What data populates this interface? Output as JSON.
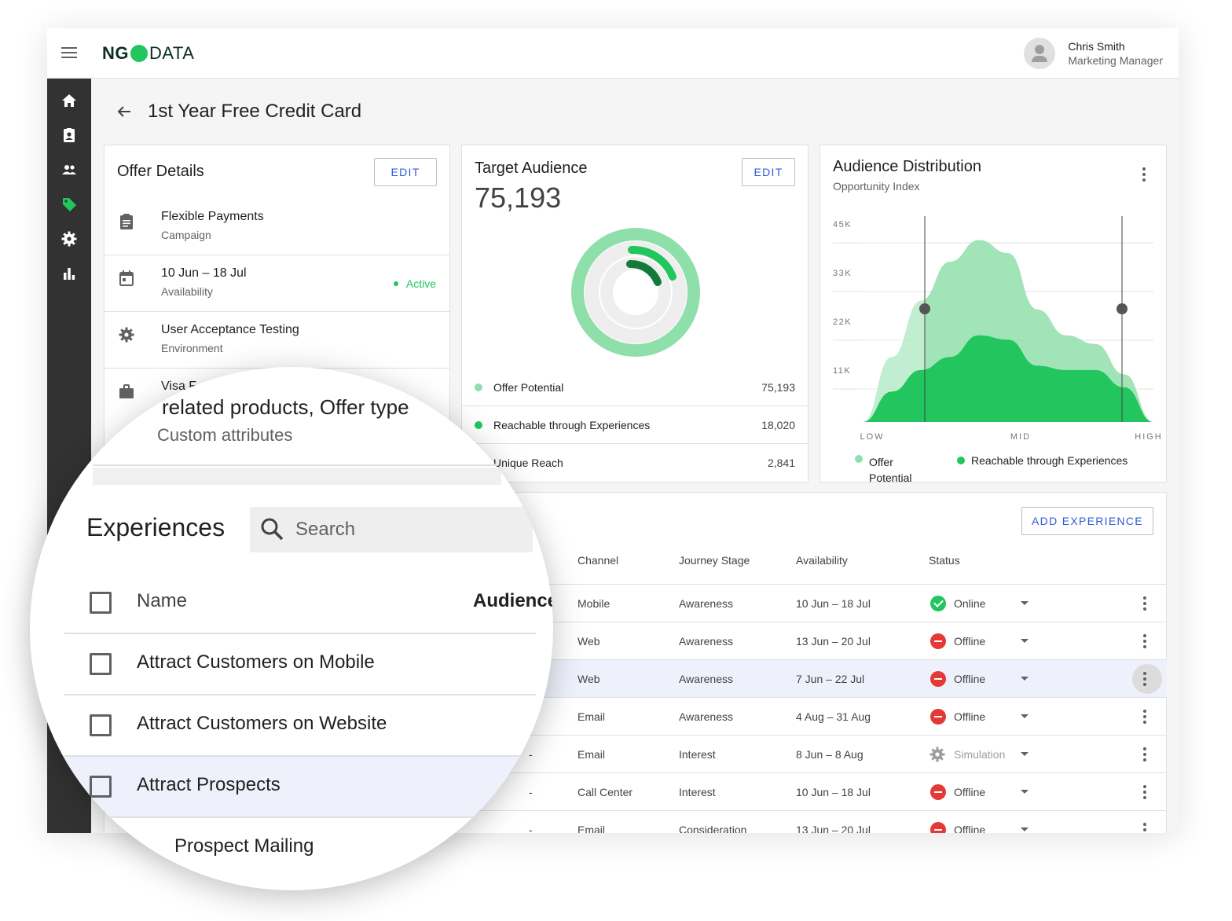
{
  "app": {
    "logo_left": "NG",
    "logo_right": "DATA",
    "user_name": "Chris Smith",
    "user_role": "Marketing Manager"
  },
  "sidebar": {
    "items": [
      {
        "icon": "home-icon"
      },
      {
        "icon": "contact-badge-icon"
      },
      {
        "icon": "people-icon"
      },
      {
        "icon": "tag-icon",
        "active": true
      },
      {
        "icon": "gear-icon"
      },
      {
        "icon": "bar-chart-icon"
      }
    ]
  },
  "page": {
    "title": "1st Year Free Credit Card"
  },
  "offer_details": {
    "title": "Offer Details",
    "edit_label": "EDIT",
    "rows": [
      {
        "icon": "clipboard-icon",
        "primary": "Flexible Payments",
        "secondary": "Campaign"
      },
      {
        "icon": "calendar-icon",
        "primary": "10 Jun – 18 Jul",
        "secondary": "Availability",
        "badge": "Active"
      },
      {
        "icon": "gear-icon",
        "primary": "User Acceptance Testing",
        "secondary": "Environment"
      },
      {
        "icon": "briefcase-icon",
        "primary": "Visa F",
        "secondary": ""
      }
    ]
  },
  "target_audience": {
    "title": "Target Audience",
    "edit_label": "EDIT",
    "total": "75,193",
    "legend": [
      {
        "label": "Offer Potential",
        "value": "75,193",
        "color": "#8fdfaa"
      },
      {
        "label": "Reachable through Experiences",
        "value": "18,020",
        "color": "#22c55e"
      },
      {
        "label": "Unique Reach",
        "value": "2,841",
        "color": "#137a3a"
      }
    ]
  },
  "audience_distribution": {
    "title": "Audience Distribution",
    "subtitle": "Opportunity Index",
    "legend_offer": "Offer",
    "legend_offer_2": "Potential",
    "legend_reach": "Reachable through Experiences"
  },
  "chart_data": {
    "type": "area",
    "x_ticks": [
      "LOW",
      "MID",
      "HIGH"
    ],
    "y_ticks": [
      "45K",
      "33K",
      "22K",
      "11K"
    ],
    "ylim": [
      0,
      45000
    ],
    "x": [
      0,
      0.1,
      0.2,
      0.3,
      0.4,
      0.5,
      0.6,
      0.7,
      0.8,
      0.9,
      1.0
    ],
    "series": [
      {
        "name": "Offer Potential",
        "color": "#8fdfaa",
        "values": [
          0,
          15000,
          28000,
          37000,
          42000,
          39000,
          26000,
          20000,
          18000,
          11000,
          0
        ]
      },
      {
        "name": "Reachable through Experiences",
        "color": "#22c55e",
        "values": [
          0,
          7000,
          12000,
          15000,
          20000,
          19000,
          13000,
          12000,
          12000,
          8000,
          0
        ]
      }
    ],
    "grid": true
  },
  "experiences": {
    "add_label": "ADD EXPERIENCE",
    "columns": [
      "Channel",
      "Journey Stage",
      "Availability",
      "Status"
    ],
    "rows": [
      {
        "channel": "Mobile",
        "stage": "Awareness",
        "availability": "10 Jun – 18 Jul",
        "status": "Online",
        "kind": "online",
        "dash": ""
      },
      {
        "channel": "Web",
        "stage": "Awareness",
        "availability": "13 Jun – 20 Jul",
        "status": "Offline",
        "kind": "offline",
        "dash": ""
      },
      {
        "channel": "Web",
        "stage": "Awareness",
        "availability": "7 Jun – 22 Jul",
        "status": "Offline",
        "kind": "offline",
        "dash": ""
      },
      {
        "channel": "Email",
        "stage": "Awareness",
        "availability": "4 Aug – 31 Aug",
        "status": "Offline",
        "kind": "offline",
        "dash": ""
      },
      {
        "channel": "Email",
        "stage": "Interest",
        "availability": "8 Jun – 8 Aug",
        "status": "Simulation",
        "kind": "sim",
        "dash": "-"
      },
      {
        "channel": "Call Center",
        "stage": "Interest",
        "availability": "10 Jun – 18 Jul",
        "status": "Offline",
        "kind": "offline",
        "dash": "-"
      },
      {
        "channel": "Email",
        "stage": "Consideration",
        "availability": "13 Jun – 20 Jul",
        "status": "Offline",
        "kind": "offline",
        "dash": "-"
      }
    ]
  },
  "magnifier": {
    "top_text": "related products, Offer type",
    "top_sub": "Custom attributes",
    "section_title": "Experiences",
    "search_placeholder": "Search",
    "col_name": "Name",
    "col_audience": "Audience",
    "rows": [
      "Attract Customers on Mobile",
      "Attract Customers on Website",
      "Attract Prospects",
      "Prospect Mailing"
    ]
  }
}
